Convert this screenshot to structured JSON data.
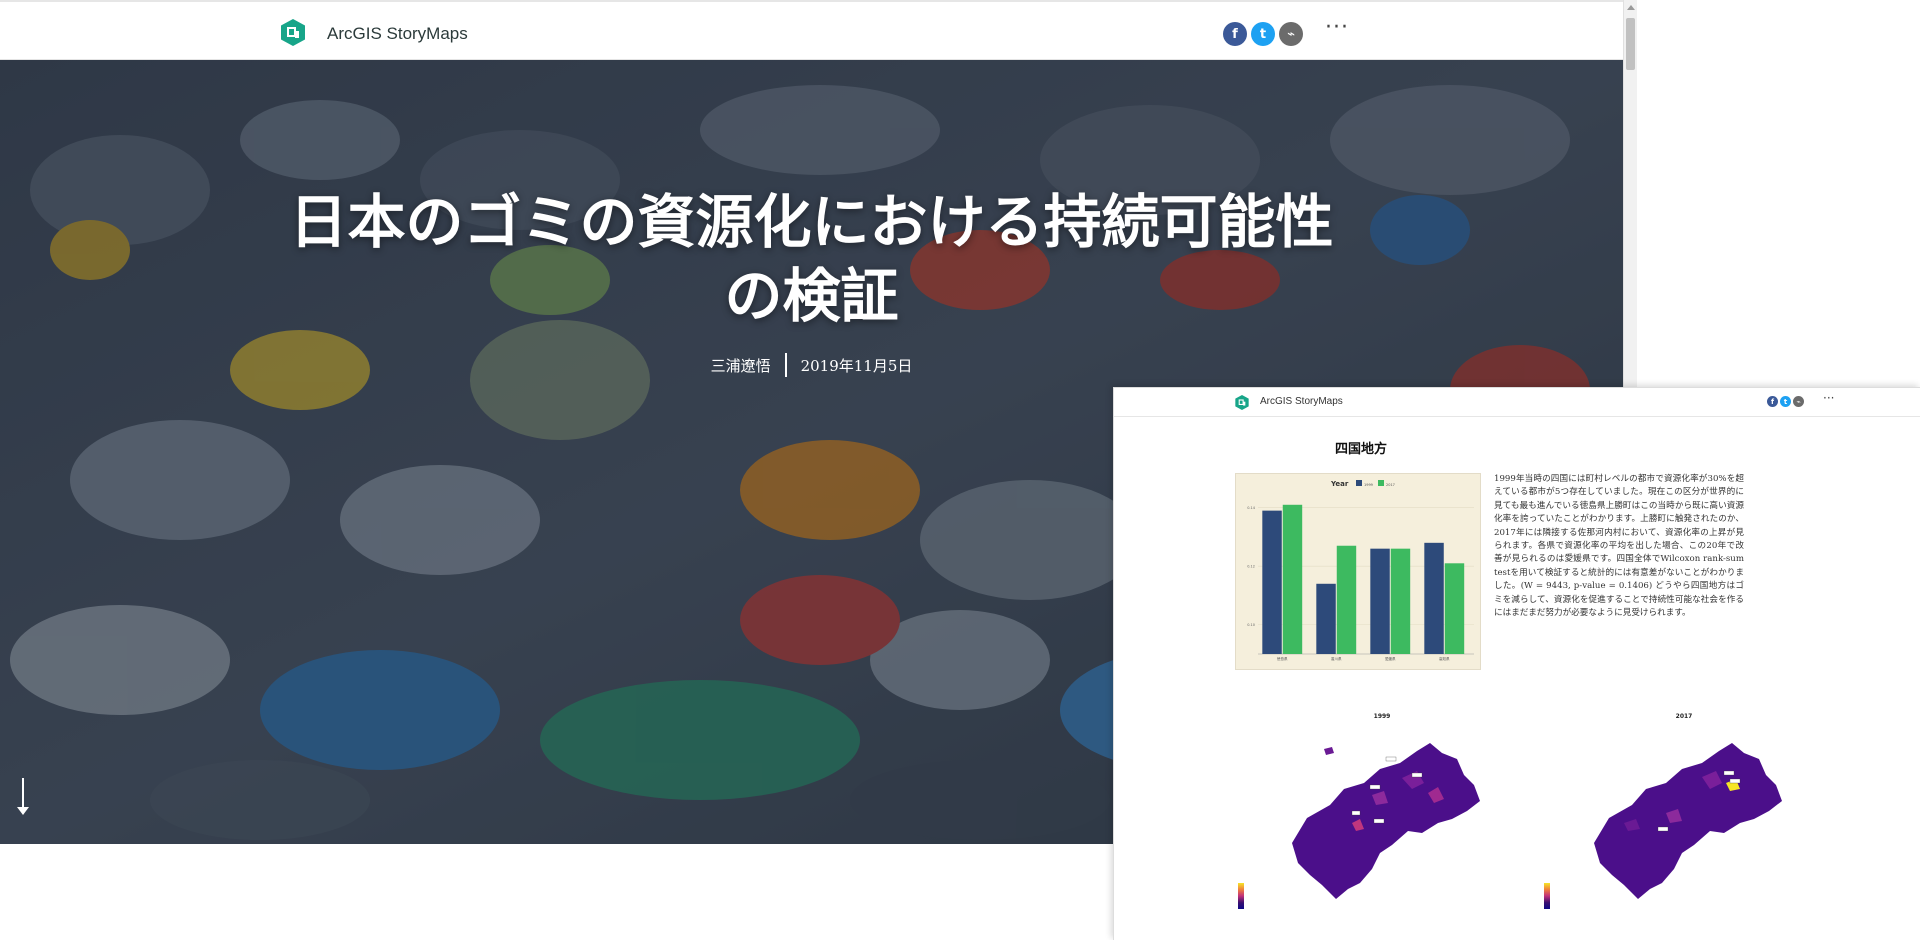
{
  "header": {
    "brand": "ArcGIS StoryMaps",
    "share": {
      "facebook_icon": "f",
      "twitter_icon": "t",
      "link_icon": "⌁"
    },
    "more_icon": "···"
  },
  "hero": {
    "title_line1": "日本のゴミの資源化における持続可能性",
    "title_line2": "の検証",
    "author": "三浦遼悟",
    "date": "2019年11月5日"
  },
  "overlay": {
    "brand": "ArcGIS StoryMaps",
    "more_icon": "···",
    "heading": "四国地方",
    "body": "1999年当時の四国には町村レベルの都市で資源化率が30%を超えている都市が5つ存在していました。現在この区分が世界的に見ても最も進んでいる徳島県上勝町はこの当時から既に高い資源化率を誇っていたことがわかります。上勝町に触発されたのか、2017年には隣接する佐那河内村において、資源化率の上昇が見られます。各県で資源化率の平均を出した場合、この20年で改善が見られるのは愛媛県です。四国全体でWilcoxon rank-sum testを用いて検証すると統計的には有意差がないことがわかりました。(W = 9443, p-value = 0.1406) どうやら四国地方はゴミを減らして、資源化を促進することで持続性可能な社会を作るにはまだまだ努力が必要なように見受けられます。",
    "map1_title": "1999",
    "map2_title": "2017"
  },
  "chart_data": {
    "type": "bar",
    "legend_title": "Year",
    "legend_position": "top",
    "categories": [
      "徳島県",
      "香川県",
      "愛媛県",
      "高知県"
    ],
    "series": [
      {
        "name": "1999",
        "color": "#2d4a7a",
        "values": [
          0.139,
          0.114,
          0.126,
          0.128
        ]
      },
      {
        "name": "2017",
        "color": "#3dba60",
        "values": [
          0.141,
          0.127,
          0.126,
          0.121
        ]
      }
    ],
    "ylim": [
      0.09,
      0.144
    ],
    "yticks": [
      0.1,
      0.12,
      0.14
    ],
    "ytick_labels": [
      "0.10",
      "0.12",
      "0.14"
    ]
  },
  "colors": {
    "facebook": "#3b5998",
    "twitter": "#1da1f2",
    "link": "#6b6b6b",
    "brand_teal": "#17a589",
    "map_fill": "#4b0f8a"
  }
}
